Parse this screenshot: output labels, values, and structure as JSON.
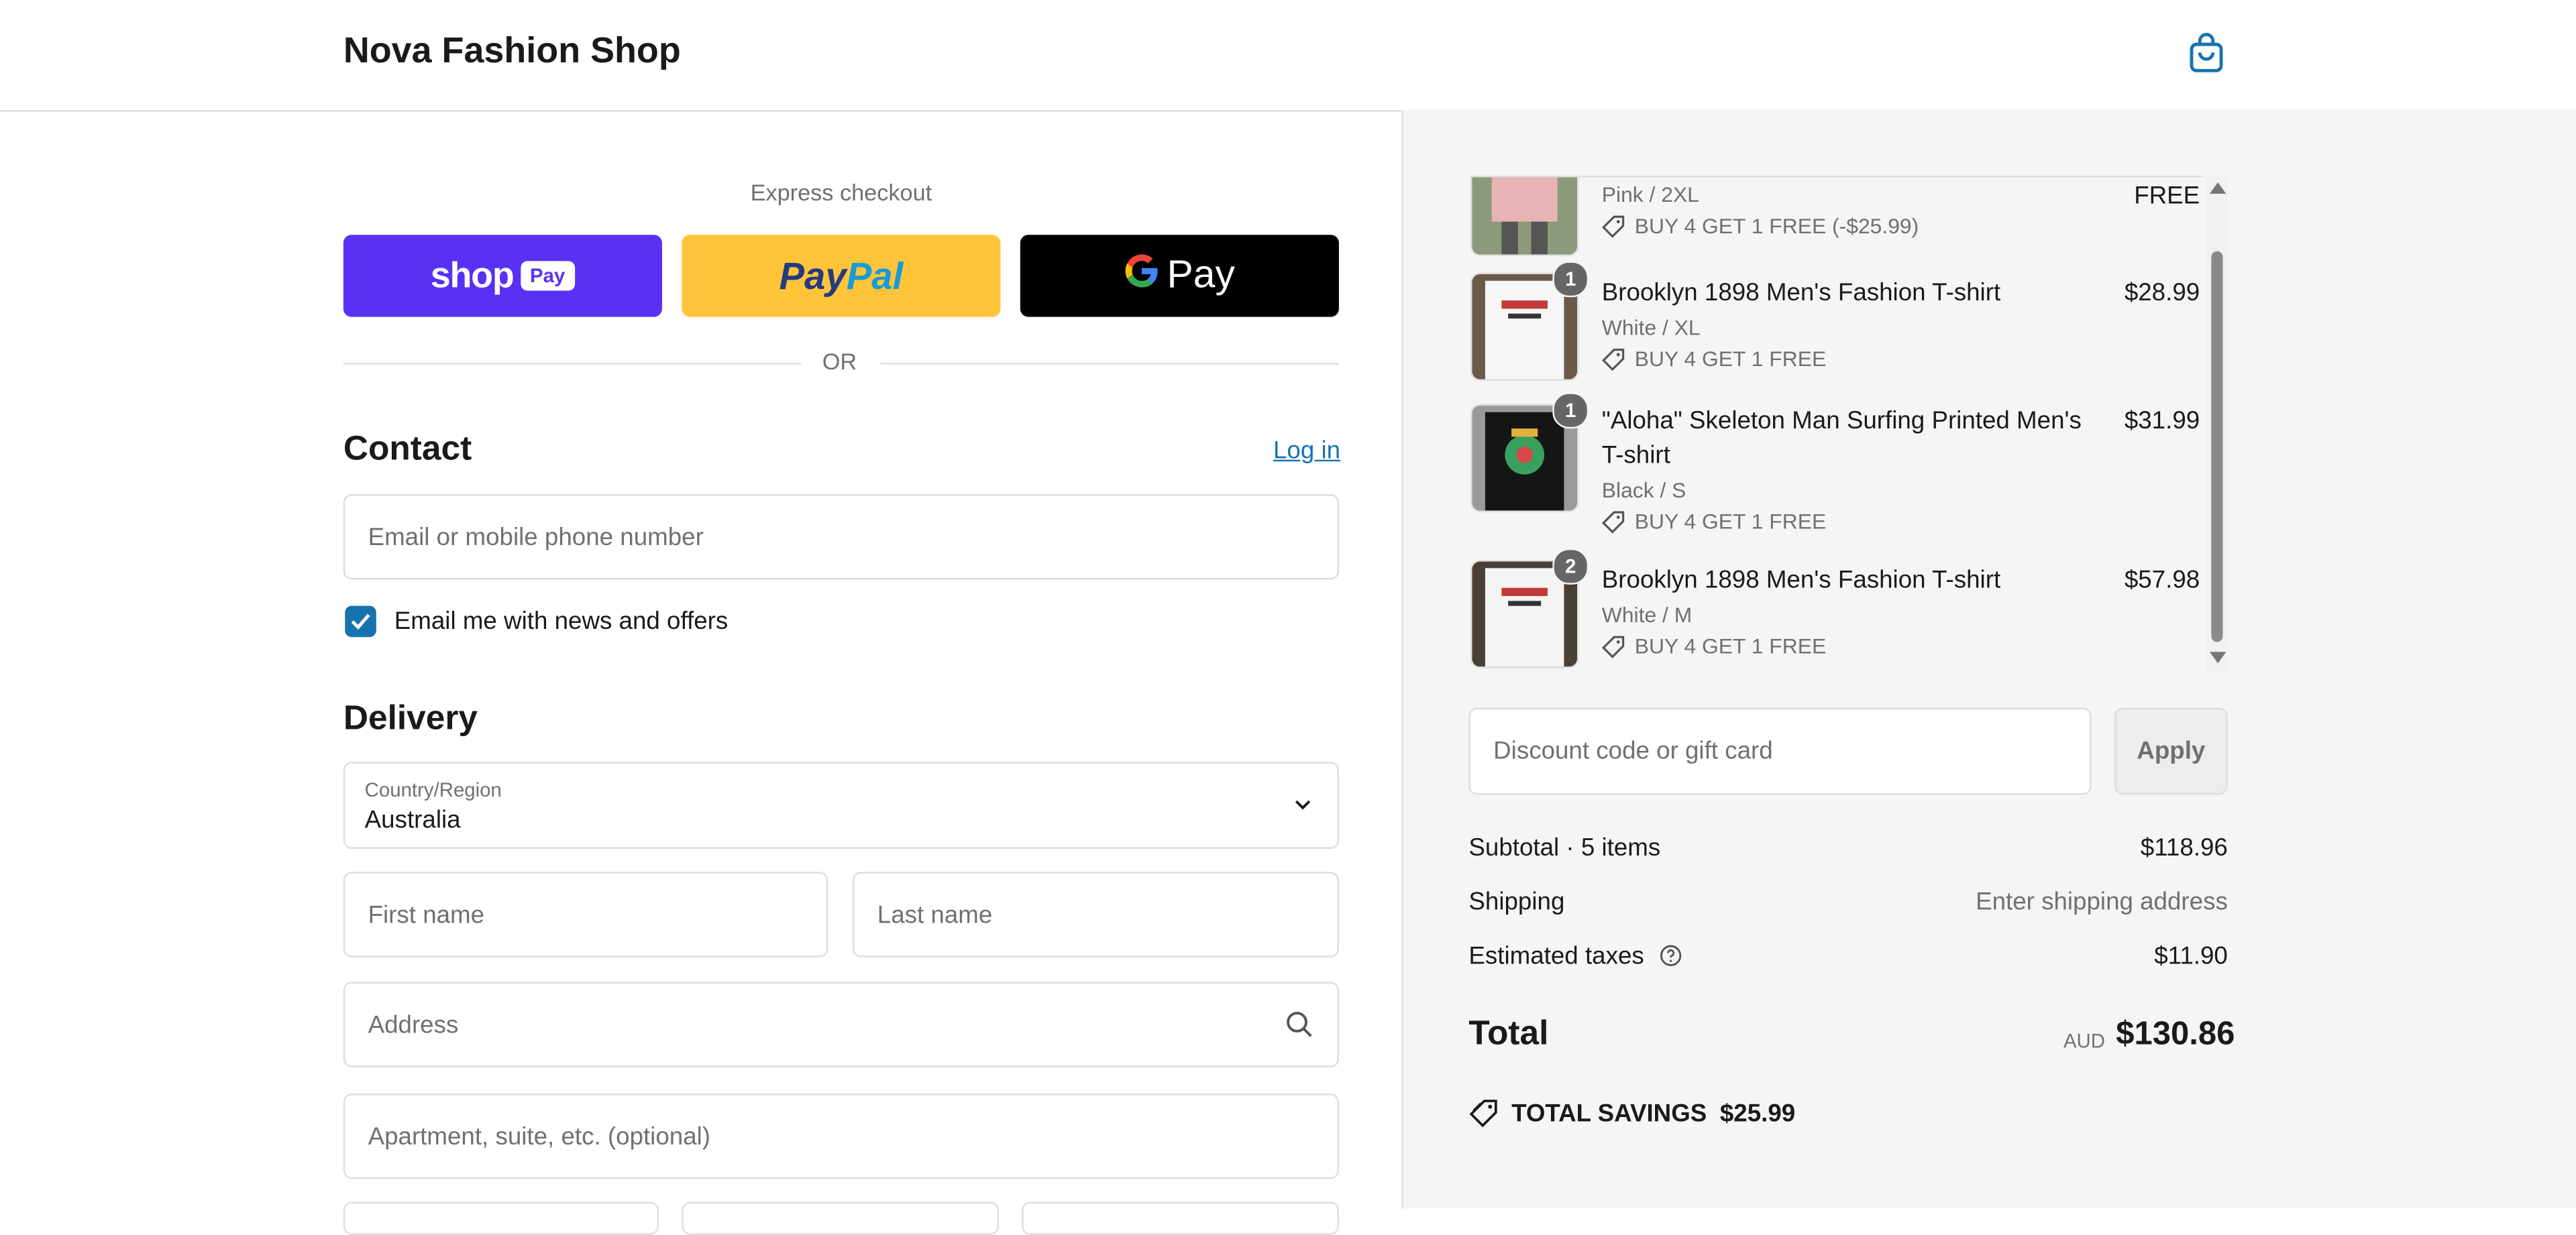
{
  "header": {
    "shop_name": "Nova Fashion Shop",
    "cart_icon": "shopping-bag-icon"
  },
  "express": {
    "title": "Express checkout",
    "shop_pay": {
      "text": "shop",
      "pill": "Pay"
    },
    "paypal": {
      "part1": "Pay",
      "part2": "Pal"
    },
    "google_pay": {
      "g": "G",
      "pay": "Pay"
    },
    "or": "OR"
  },
  "contact": {
    "title": "Contact",
    "login": "Log in",
    "email_placeholder": "Email or mobile phone number",
    "newsletter_label": "Email me with news and offers",
    "newsletter_checked": true
  },
  "delivery": {
    "title": "Delivery",
    "country_label": "Country/Region",
    "country_value": "Australia",
    "first_name_placeholder": "First name",
    "last_name_placeholder": "Last name",
    "address_placeholder": "Address",
    "apartment_placeholder": "Apartment, suite, etc. (optional)"
  },
  "summary": {
    "items": [
      {
        "name": "",
        "variant": "Pink / 2XL",
        "promo": "BUY 4 GET 1 FREE (-$25.99)",
        "price": "FREE",
        "qty": ""
      },
      {
        "name": "Brooklyn 1898 Men's Fashion T-shirt",
        "variant": "White / XL",
        "promo": "BUY 4 GET 1 FREE",
        "price": "$28.99",
        "qty": "1"
      },
      {
        "name": "\"Aloha\" Skeleton Man Surfing Printed Men's T-shirt",
        "variant": "Black / S",
        "promo": "BUY 4 GET 1 FREE",
        "price": "$31.99",
        "qty": "1"
      },
      {
        "name": "Brooklyn 1898 Men's Fashion T-shirt",
        "variant": "White / M",
        "promo": "BUY 4 GET 1 FREE",
        "price": "$57.98",
        "qty": "2"
      }
    ],
    "discount_placeholder": "Discount code or gift card",
    "apply": "Apply",
    "subtotal_label": "Subtotal · 5 items",
    "subtotal_value": "$118.96",
    "shipping_label": "Shipping",
    "shipping_value": "Enter shipping address",
    "taxes_label": "Estimated taxes",
    "taxes_value": "$11.90",
    "total_label": "Total",
    "total_currency": "AUD",
    "total_value": "$130.86",
    "savings_label": "TOTAL SAVINGS",
    "savings_value": "$25.99"
  },
  "colors": {
    "accent": "#1773b0",
    "shop_pay": "#5a31f4",
    "paypal": "#ffc439",
    "summary_bg": "#f5f5f5"
  }
}
